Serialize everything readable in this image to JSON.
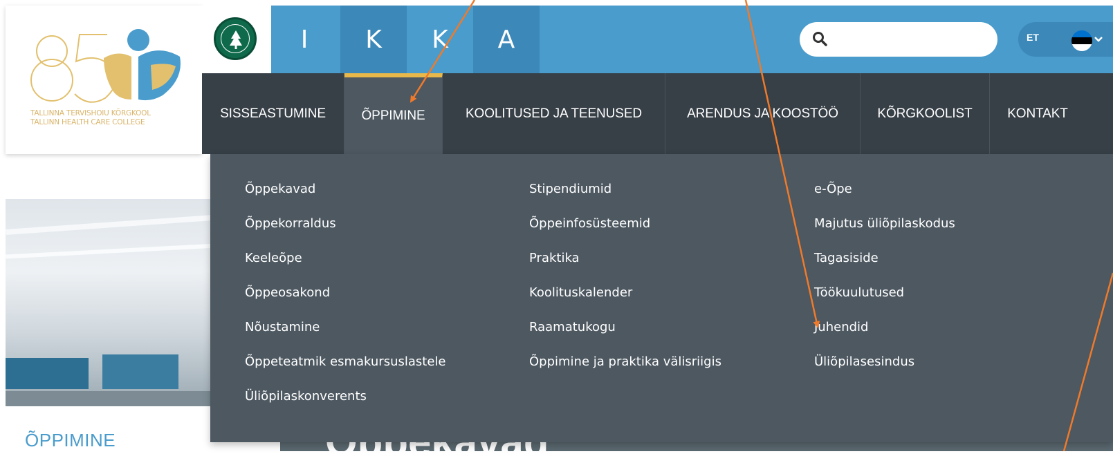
{
  "logo": {
    "line1": "TALLINNA TERVISHOIU KÕRGKOOL",
    "line2": "TALLINN HEALTH CARE COLLEGE",
    "mark": "85",
    "accent_gold": "#e2c06e",
    "accent_blue": "#4a9ccc"
  },
  "accreditation_badge": {
    "icon": "tree-seal-icon"
  },
  "header": {
    "ikka_letters": [
      "I",
      "K",
      "K",
      "A"
    ],
    "search": {
      "placeholder": "",
      "value": ""
    },
    "language": {
      "code": "ET",
      "flag": "estonia-flag"
    }
  },
  "nav": {
    "items": [
      {
        "label": "SISSEASTUMINE"
      },
      {
        "label": "ÕPPIMINE",
        "active": true
      },
      {
        "label": "KOOLITUSED JA TEENUSED"
      },
      {
        "label": "ARENDUS JA KOOSTÖÖ"
      },
      {
        "label": "KÕRGKOOLIST"
      },
      {
        "label": "KONTAKT"
      }
    ],
    "active_indicator_color": "#e8b94a"
  },
  "dropdown": {
    "col1": [
      "Õppekavad",
      "Õppekorraldus",
      "Keeleõpe",
      "Õppeosakond",
      "Nõustamine",
      "Õppeteatmik esmakursuslastele",
      "Üliõpilaskonverents"
    ],
    "col2": [
      "Stipendiumid",
      "Õppeinfosüsteemid",
      "Praktika",
      "Koolituskalender",
      "Raamatukogu",
      "Õppimine ja praktika välisriigis"
    ],
    "col3": [
      "e-Õpe",
      "Majutus üliõpilaskodus",
      "Tagasiside",
      "Töökuulutused",
      "Juhendid",
      "Üliõpilasesindus"
    ]
  },
  "section": {
    "title": "ÕPPIMINE"
  },
  "page": {
    "heading": "Õppekavad"
  },
  "annotation_color": "#f07a2a"
}
